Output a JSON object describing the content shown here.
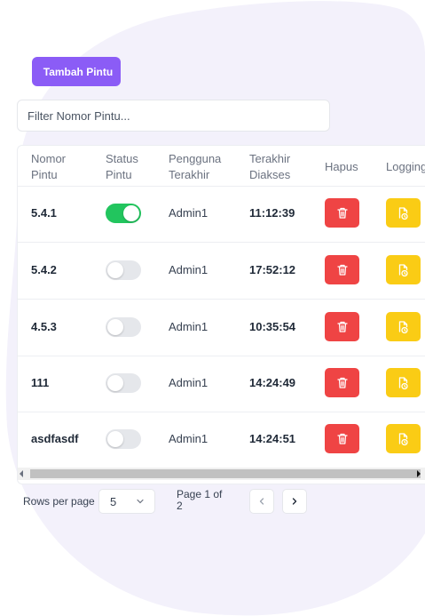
{
  "add_button": {
    "label": "Tambah Pintu"
  },
  "filter": {
    "placeholder": "Filter Nomor Pintu..."
  },
  "table": {
    "columns": [
      {
        "line1": "Nomor",
        "line2": "Pintu"
      },
      {
        "line1": "Status",
        "line2": "Pintu"
      },
      {
        "line1": "Pengguna",
        "line2": "Terakhir"
      },
      {
        "line1": "Terakhir",
        "line2": "Diakses"
      },
      {
        "line1": "Hapus",
        "line2": ""
      },
      {
        "line1": "Logging",
        "line2": ""
      }
    ],
    "rows": [
      {
        "nomor": "5.4.1",
        "status_on": true,
        "pengguna": "Admin1",
        "waktu": "11:12:39"
      },
      {
        "nomor": "5.4.2",
        "status_on": false,
        "pengguna": "Admin1",
        "waktu": "17:52:12"
      },
      {
        "nomor": "4.5.3",
        "status_on": false,
        "pengguna": "Admin1",
        "waktu": "10:35:54"
      },
      {
        "nomor": "111",
        "status_on": false,
        "pengguna": "Admin1",
        "waktu": "14:24:49"
      },
      {
        "nomor": "asdfasdf",
        "status_on": false,
        "pengguna": "Admin1",
        "waktu": "14:24:51"
      }
    ]
  },
  "pagination": {
    "rows_per_page_label": "Rows per page",
    "rows_per_page_value": "5",
    "page_info_line1": "Page 1 of",
    "page_info_line2": "2"
  },
  "colors": {
    "accent": "#8b5cf6",
    "toggle_on": "#22c55e",
    "delete": "#ef4444",
    "logging": "#facc15",
    "background_blob": "#f3f1fb"
  },
  "icons": {
    "delete": "trash-icon",
    "logging": "document-clock-icon",
    "prev": "chevron-left-icon",
    "next": "chevron-right-icon",
    "select": "chevron-down-icon"
  }
}
